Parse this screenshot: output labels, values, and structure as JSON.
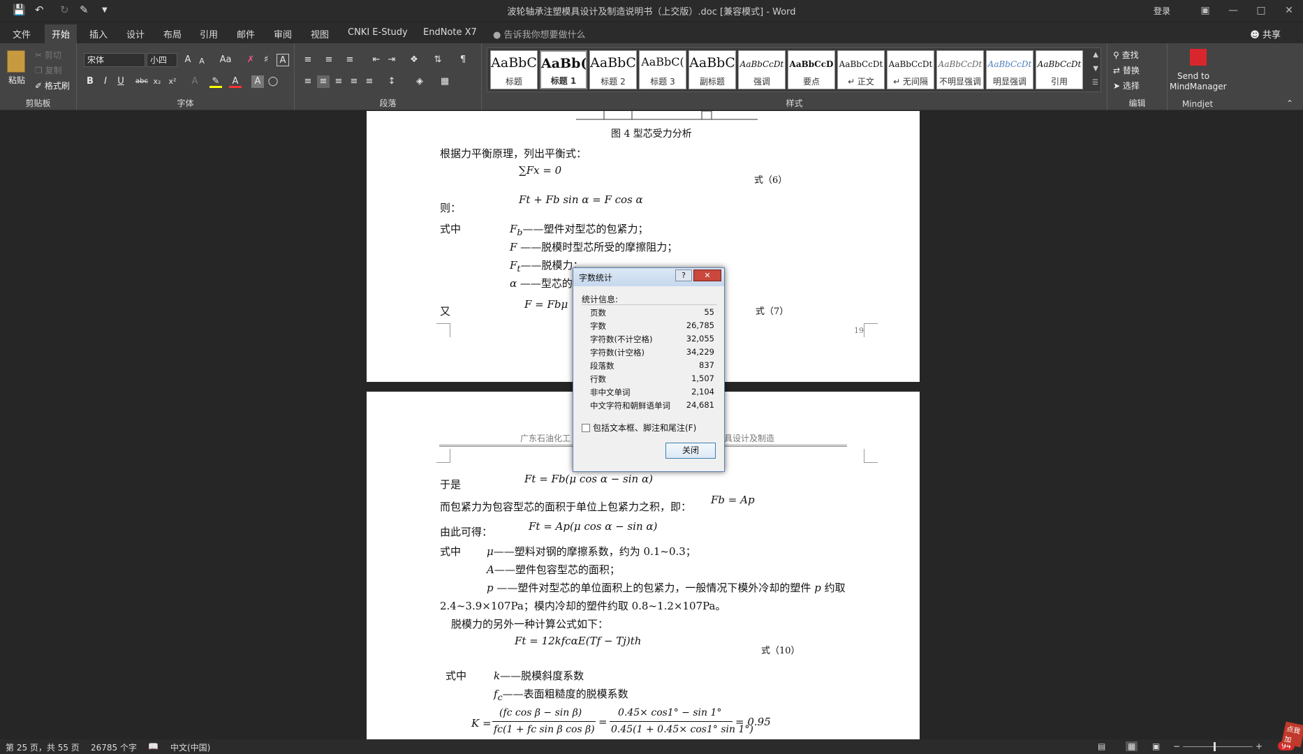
{
  "window": {
    "title": "波轮轴承注塑模具设计及制造说明书（上交版）.doc [兼容模式] - Word",
    "login": "登录",
    "share": "共享",
    "tell_me": "告诉我你想要做什么"
  },
  "tabs": [
    "文件",
    "开始",
    "插入",
    "设计",
    "布局",
    "引用",
    "邮件",
    "审阅",
    "视图",
    "CNKI E-Study",
    "EndNote X7"
  ],
  "ribbon": {
    "clipboard": {
      "label": "剪贴板",
      "paste": "粘贴",
      "cut": "剪切",
      "copy": "复制",
      "painter": "格式刷"
    },
    "font": {
      "label": "字体",
      "name": "宋体",
      "size": "小四",
      "aa": "Aa"
    },
    "paragraph": {
      "label": "段落"
    },
    "styles": {
      "label": "样式",
      "items": [
        {
          "sample": "AaBbC",
          "name": "标题"
        },
        {
          "sample": "AaBb(",
          "name": "标题 1"
        },
        {
          "sample": "AaBbC",
          "name": "标题 2"
        },
        {
          "sample": "AaBbC(",
          "name": "标题 3"
        },
        {
          "sample": "AaBbC",
          "name": "副标题"
        },
        {
          "sample": "AaBbCcDt",
          "name": "强调"
        },
        {
          "sample": "AaBbCcD",
          "name": "要点"
        },
        {
          "sample": "AaBbCcDt",
          "name": "↵ 正文"
        },
        {
          "sample": "AaBbCcDt",
          "name": "↵ 无间隔"
        },
        {
          "sample": "AaBbCcDt",
          "name": "不明显强调"
        },
        {
          "sample": "AaBbCcDt",
          "name": "明显强调"
        },
        {
          "sample": "AaBbCcDt",
          "name": "引用"
        }
      ]
    },
    "editing": {
      "label": "编辑",
      "find": "查找",
      "replace": "替换",
      "select": "选择"
    },
    "mindjet": {
      "label": "Mindjet",
      "send": "Send to",
      "app": "MindManager"
    }
  },
  "page1": {
    "caption": "图 4  型芯受力分析",
    "line1": "根据力平衡原理，列出平衡式：",
    "eq_sum": "∑Fx = 0",
    "eq6": "式（6）",
    "ze": "则：",
    "eq_balance": "Ft + Fb sin α = F cos α",
    "shizhong": "式中",
    "def_fb": "——塑件对型芯的包紧力；",
    "def_f": "——脱模时型芯所受的摩擦阻力；",
    "def_ft": "——脱模力；",
    "def_alpha": "——型芯的",
    "you": "又",
    "eq_f": "F = Fbμ",
    "eq7": "式（7）",
    "page_num": "19"
  },
  "page2": {
    "header": "广东石油化工",
    "header_right": "模具设计及制造",
    "yushi": "于是",
    "eq_ft": "Ft = Fb(μ cos α − sin α)",
    "baojin": "而包紧力为包容型芯的面积于单位上包紧力之积，即：",
    "eq_fb": "Fb = Ap",
    "youci": "由此可得：",
    "eq_ft2": "Ft = Ap(μ cos α − sin α)",
    "shizhong": "式中",
    "def_mu": "——塑料对钢的摩擦系数，约为 0.1~0.3；",
    "def_a": "——塑件包容型芯的面积；",
    "def_p": "——塑件对型芯的单位面积上的包紧力，一般情况下模外冷却的塑件",
    "def_p2": "约取",
    "def_p3": "2.4~3.9×107Pa；模内冷却的塑件约取 0.8~1.2×107Pa。",
    "tuomo": "脱模力的另外一种计算公式如下：",
    "eq_ft3": "Ft = 12kfcαE(Tf − Tj)th",
    "eq10": "式（10）",
    "shizhong2": "式中",
    "def_k": "——脱模斜度系数",
    "def_fc": "——表面粗糙度的脱模系数",
    "eq_K_lhs": "K =",
    "eq_K_num1": "(fc cos β − sin β)",
    "eq_K_den1": "fc(1 + fc sin β cos β)",
    "eq_K_num2": "0.45× cos1° − sin 1°",
    "eq_K_den2": "0.45(1 + 0.45× cos1° sin 1°)",
    "eq_K_res": "= 0.95"
  },
  "dialog": {
    "title": "字数统计",
    "help": "?",
    "section": "统计信息:",
    "rows": [
      {
        "label": "页数",
        "value": "55"
      },
      {
        "label": "字数",
        "value": "26,785"
      },
      {
        "label": "字符数(不计空格)",
        "value": "32,055"
      },
      {
        "label": "字符数(计空格)",
        "value": "34,229"
      },
      {
        "label": "段落数",
        "value": "837"
      },
      {
        "label": "行数",
        "value": "1,507"
      },
      {
        "label": "非中文单词",
        "value": "2,104"
      },
      {
        "label": "中文字符和朝鲜语单词",
        "value": "24,681"
      }
    ],
    "checkbox": "包括文本框、脚注和尾注(F)",
    "close": "关闭"
  },
  "status": {
    "page": "第 25 页，共 55 页",
    "words": "26785 个字",
    "lang": "中文(中国)",
    "zoom_badge": "94",
    "corner": "点我加"
  }
}
